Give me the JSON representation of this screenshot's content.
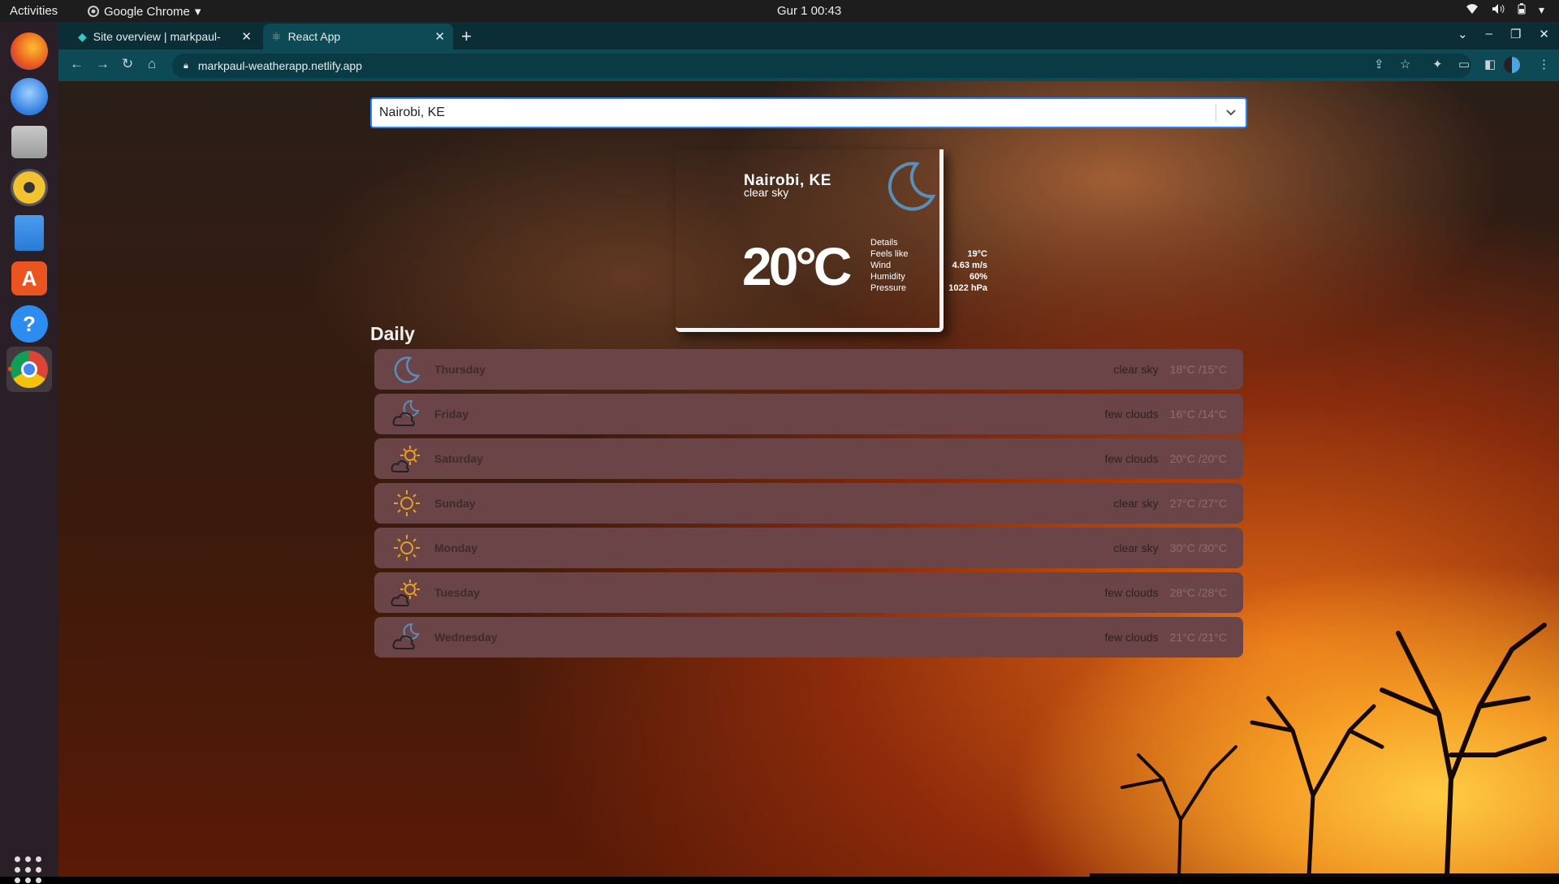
{
  "topbar": {
    "activities": "Activities",
    "app_name": "Google Chrome",
    "clock": "Gur 1  00:43"
  },
  "dock": {
    "items": [
      {
        "name": "firefox",
        "color": "#e6561f"
      },
      {
        "name": "thunderbird",
        "color": "#2f7de1"
      },
      {
        "name": "files",
        "color": "#9a9a9a"
      },
      {
        "name": "rhythmbox",
        "color": "#f2c230"
      },
      {
        "name": "libreoffice-writer",
        "color": "#2a7bd4"
      },
      {
        "name": "software",
        "color": "#e95420"
      },
      {
        "name": "help",
        "color": "#2d8cf0"
      },
      {
        "name": "chrome",
        "color": "#4285f4"
      }
    ]
  },
  "browser": {
    "tabs": [
      {
        "title": "Site overview | markpaul-"
      },
      {
        "title": "React App"
      }
    ],
    "url": "markpaul-weatherapp.netlify.app"
  },
  "app": {
    "search": {
      "value": "Nairobi, KE"
    },
    "current": {
      "city": "Nairobi, KE",
      "description": "clear sky",
      "temperature": "20°C",
      "details_label": "Details",
      "details": [
        {
          "label": "Feels like",
          "value": "19°C"
        },
        {
          "label": "Wind",
          "value": "4.63 m/s"
        },
        {
          "label": "Humidity",
          "value": "60%"
        },
        {
          "label": "Pressure",
          "value": "1022 hPa"
        }
      ]
    },
    "daily_title": "Daily",
    "daily": [
      {
        "day": "Thursday",
        "description": "clear sky",
        "range": "18°C /15°C",
        "icon": "moon-icon"
      },
      {
        "day": "Friday",
        "description": "few clouds",
        "range": "16°C /14°C",
        "icon": "cloud-moon-icon"
      },
      {
        "day": "Saturday",
        "description": "few clouds",
        "range": "20°C /20°C",
        "icon": "cloud-sun-icon"
      },
      {
        "day": "Sunday",
        "description": "clear sky",
        "range": "27°C /27°C",
        "icon": "sun-icon"
      },
      {
        "day": "Monday",
        "description": "clear sky",
        "range": "30°C /30°C",
        "icon": "sun-icon"
      },
      {
        "day": "Tuesday",
        "description": "few clouds",
        "range": "28°C /28°C",
        "icon": "cloud-sun-icon"
      },
      {
        "day": "Wednesday",
        "description": "few clouds",
        "range": "21°C /21°C",
        "icon": "cloud-moon-icon"
      }
    ]
  }
}
